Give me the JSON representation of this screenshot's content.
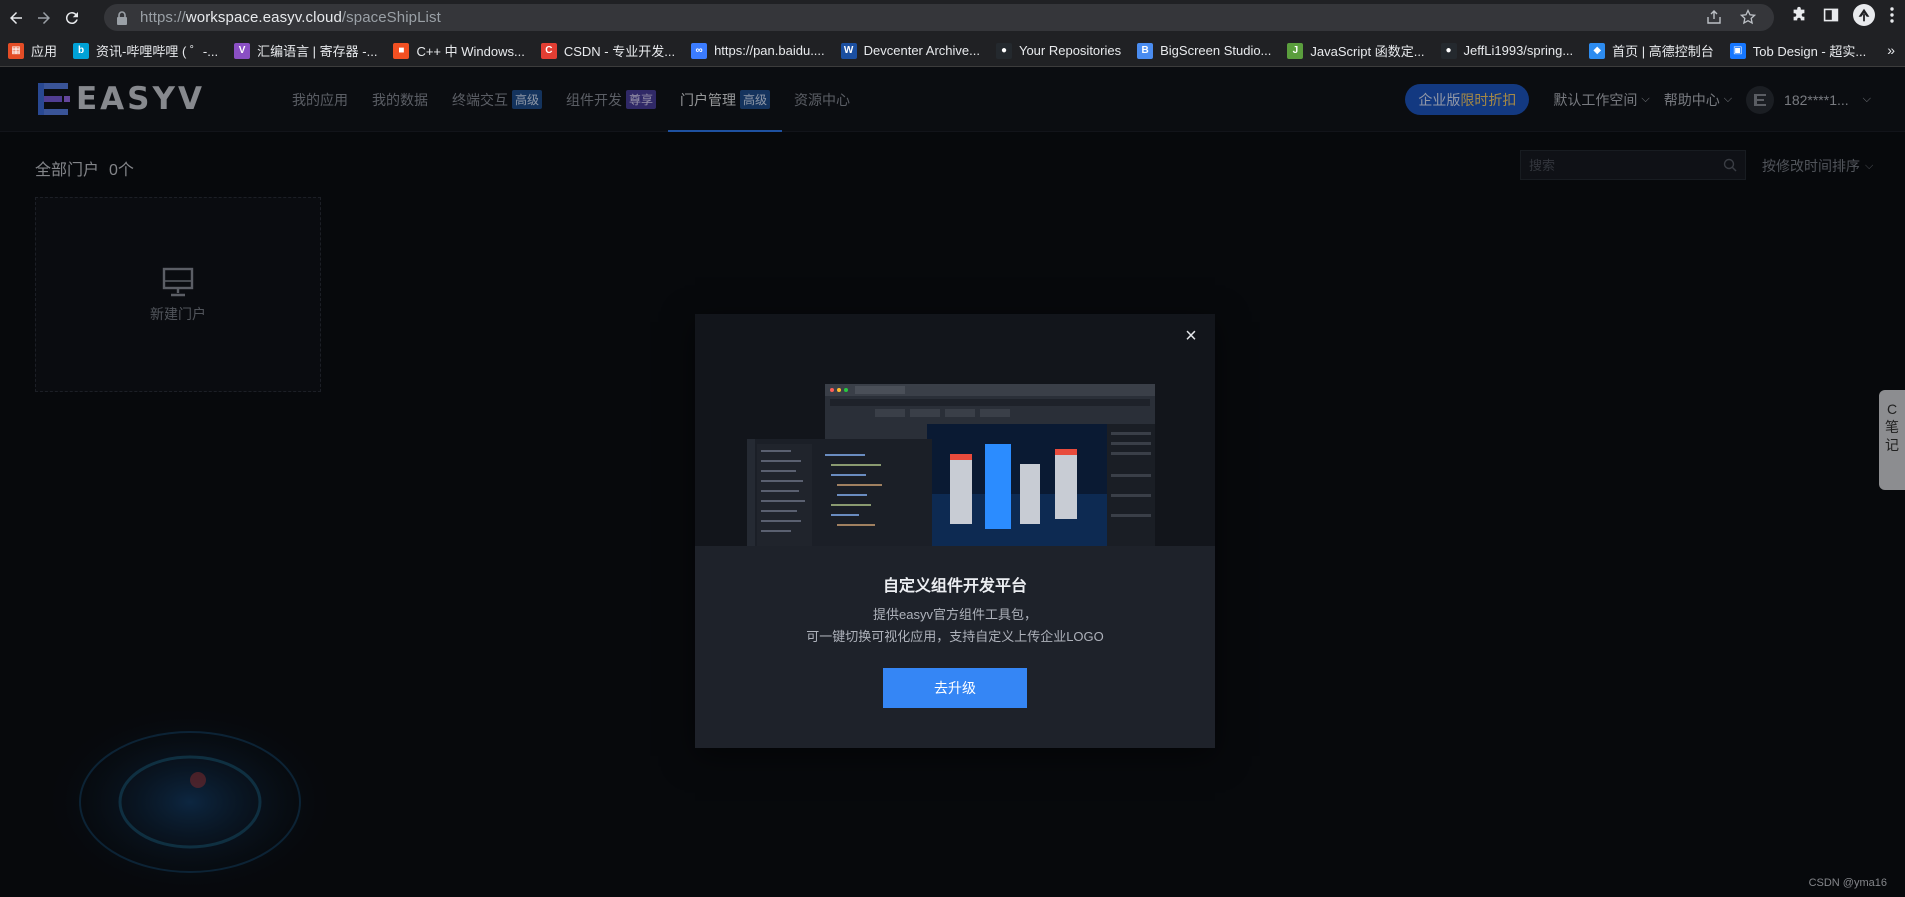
{
  "browser": {
    "url_prefix": "https://",
    "url_host": "workspace.easyv.cloud",
    "url_path": "/spaceShipList",
    "bookmarks": [
      {
        "label": "应用",
        "color": "#e44d26",
        "glyph": "▦"
      },
      {
        "label": "资讯-哔哩哔哩 ( ゜-...",
        "color": "#00a1d6",
        "glyph": "b"
      },
      {
        "label": "汇编语言 | 寄存器 -...",
        "color": "#8a4fc4",
        "glyph": "V"
      },
      {
        "label": "C++ 中 Windows...",
        "color": "#f25022",
        "glyph": "■"
      },
      {
        "label": "CSDN - 专业开发...",
        "color": "#e33e33",
        "glyph": "C"
      },
      {
        "label": "https://pan.baidu....",
        "color": "#3b7cff",
        "glyph": "∞"
      },
      {
        "label": "Devcenter Archive...",
        "color": "#1b4fa0",
        "glyph": "W"
      },
      {
        "label": "Your Repositories",
        "color": "#24292e",
        "glyph": "●"
      },
      {
        "label": "BigScreen Studio...",
        "color": "#4a8cf0",
        "glyph": "B"
      },
      {
        "label": "JavaScript 函数定...",
        "color": "#5a9e3d",
        "glyph": "J"
      },
      {
        "label": "JeffLi1993/spring...",
        "color": "#24292e",
        "glyph": "●"
      },
      {
        "label": "首页 | 高德控制台",
        "color": "#2d8cf0",
        "glyph": "◆"
      },
      {
        "label": "Tob Design - 超实...",
        "color": "#1677ff",
        "glyph": "▣"
      }
    ],
    "more": "»"
  },
  "header": {
    "logo_text": "EASYV",
    "nav": [
      {
        "label": "我的应用",
        "tag": "",
        "active": false
      },
      {
        "label": "我的数据",
        "tag": "",
        "active": false
      },
      {
        "label": "终端交互",
        "tag": "高级",
        "active": false
      },
      {
        "label": "组件开发",
        "tag": "尊享",
        "active": false
      },
      {
        "label": "门户管理",
        "tag": "高级",
        "active": true
      },
      {
        "label": "资源中心",
        "tag": "",
        "active": false
      }
    ],
    "promo_prefix": "企业版",
    "promo_highlight": "限时折扣",
    "workspace": "默认工作空间",
    "help": "帮助中心",
    "user": "182****1..."
  },
  "main": {
    "title": "全部门户",
    "count": "0个",
    "search_placeholder": "搜索",
    "sort_label": "按修改时间排序",
    "new_card_label": "新建门户",
    "side_tab_lines": [
      "C",
      "笔",
      "记"
    ],
    "watermark": "CSDN @yma16"
  },
  "modal": {
    "title": "自定义组件开发平台",
    "desc_line1": "提供easyv官方组件工具包，",
    "desc_line2": "可一键切换可视化应用，支持自定义上传企业LOGO",
    "button": "去升级",
    "close": "×"
  },
  "colors": {
    "accent": "#3586f5",
    "tag_blue": "#1f4f8f",
    "tag_purple": "#4b3f9e",
    "promo": "#1e58c6"
  }
}
